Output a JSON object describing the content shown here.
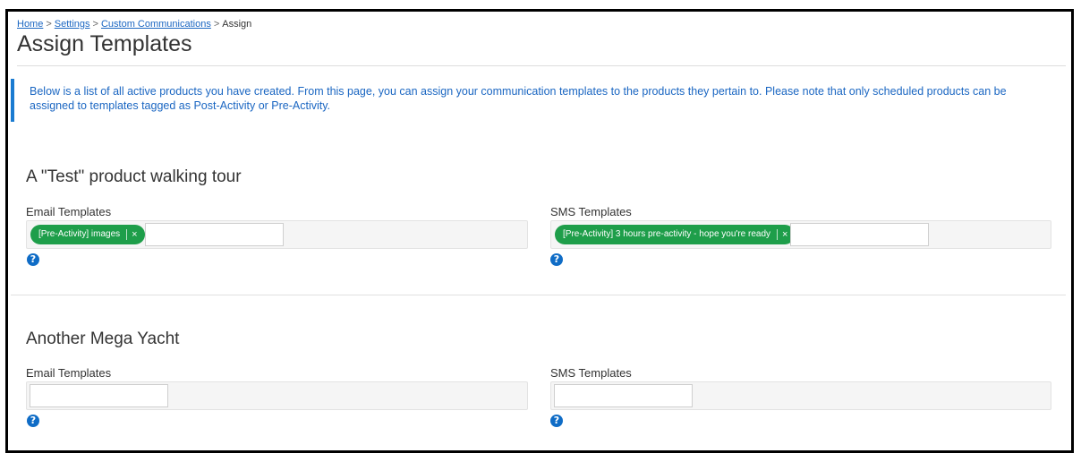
{
  "breadcrumb": {
    "home": "Home",
    "settings": "Settings",
    "custom_communications": "Custom Communications",
    "current": "Assign",
    "separator": ">"
  },
  "page_title": "Assign Templates",
  "info_text": "Below is a list of all active products you have created. From this page, you can assign your communication templates to the products they pertain to. Please note that only scheduled products can be assigned to templates tagged as Post-Activity or Pre-Activity.",
  "products": [
    {
      "title": "A \"Test\" product walking tour",
      "email_label": "Email Templates",
      "email_tag": "[Pre-Activity] images",
      "sms_label": "SMS Templates",
      "sms_tag": "[Pre-Activity] 3 hours pre-activity - hope you're ready"
    },
    {
      "title": "Another Mega Yacht",
      "email_label": "Email Templates",
      "sms_label": "SMS Templates"
    }
  ],
  "icons": {
    "help": "question-circle-icon",
    "remove": "close-icon"
  },
  "glyphs": {
    "help": "?",
    "remove": "×"
  },
  "colors": {
    "link": "#1a66c2",
    "info_bar": "#1a7bd1",
    "tag": "#1e9e4a",
    "help": "#0f6cc6"
  }
}
